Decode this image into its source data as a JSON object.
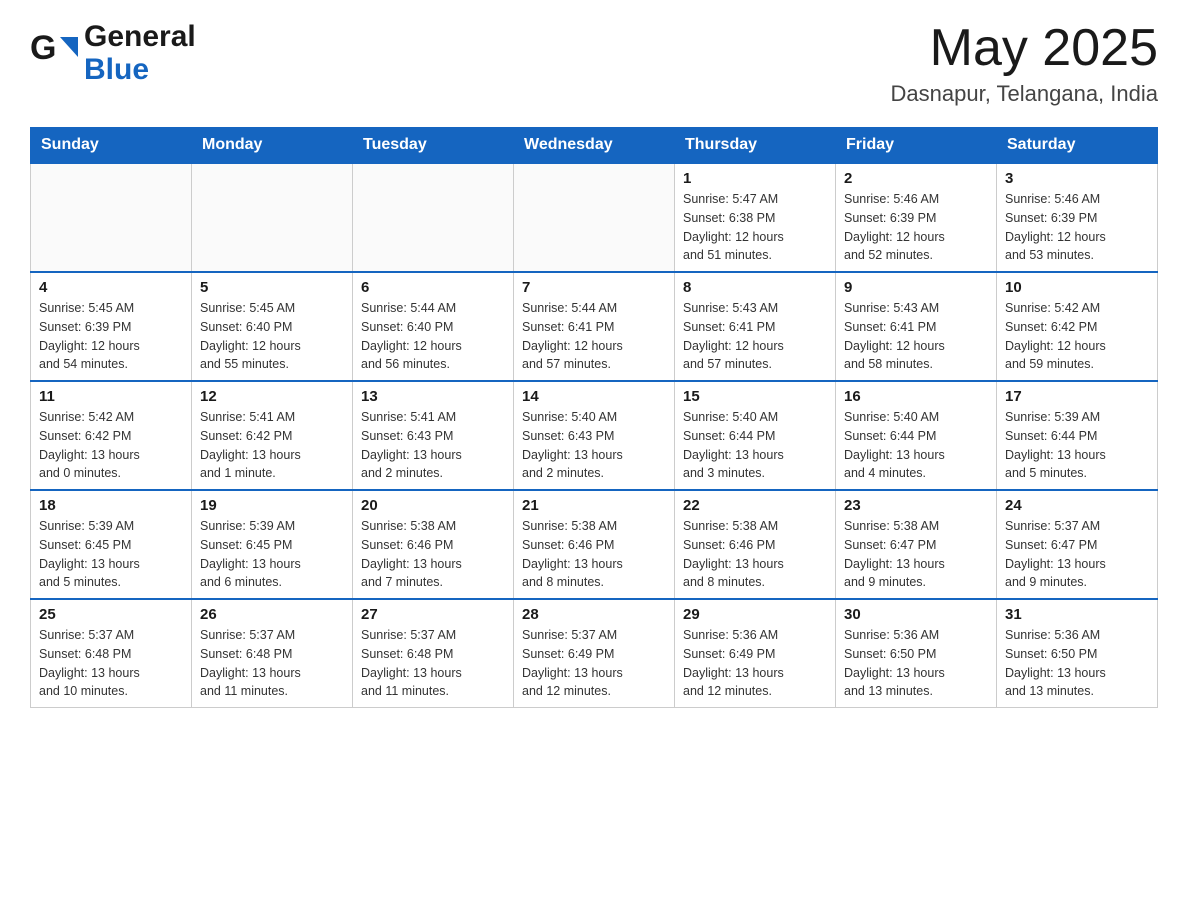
{
  "header": {
    "logo_general": "General",
    "logo_blue": "Blue",
    "month_title": "May 2025",
    "location": "Dasnapur, Telangana, India"
  },
  "days_of_week": [
    "Sunday",
    "Monday",
    "Tuesday",
    "Wednesday",
    "Thursday",
    "Friday",
    "Saturday"
  ],
  "weeks": [
    [
      {
        "day": "",
        "info": ""
      },
      {
        "day": "",
        "info": ""
      },
      {
        "day": "",
        "info": ""
      },
      {
        "day": "",
        "info": ""
      },
      {
        "day": "1",
        "info": "Sunrise: 5:47 AM\nSunset: 6:38 PM\nDaylight: 12 hours\nand 51 minutes."
      },
      {
        "day": "2",
        "info": "Sunrise: 5:46 AM\nSunset: 6:39 PM\nDaylight: 12 hours\nand 52 minutes."
      },
      {
        "day": "3",
        "info": "Sunrise: 5:46 AM\nSunset: 6:39 PM\nDaylight: 12 hours\nand 53 minutes."
      }
    ],
    [
      {
        "day": "4",
        "info": "Sunrise: 5:45 AM\nSunset: 6:39 PM\nDaylight: 12 hours\nand 54 minutes."
      },
      {
        "day": "5",
        "info": "Sunrise: 5:45 AM\nSunset: 6:40 PM\nDaylight: 12 hours\nand 55 minutes."
      },
      {
        "day": "6",
        "info": "Sunrise: 5:44 AM\nSunset: 6:40 PM\nDaylight: 12 hours\nand 56 minutes."
      },
      {
        "day": "7",
        "info": "Sunrise: 5:44 AM\nSunset: 6:41 PM\nDaylight: 12 hours\nand 57 minutes."
      },
      {
        "day": "8",
        "info": "Sunrise: 5:43 AM\nSunset: 6:41 PM\nDaylight: 12 hours\nand 57 minutes."
      },
      {
        "day": "9",
        "info": "Sunrise: 5:43 AM\nSunset: 6:41 PM\nDaylight: 12 hours\nand 58 minutes."
      },
      {
        "day": "10",
        "info": "Sunrise: 5:42 AM\nSunset: 6:42 PM\nDaylight: 12 hours\nand 59 minutes."
      }
    ],
    [
      {
        "day": "11",
        "info": "Sunrise: 5:42 AM\nSunset: 6:42 PM\nDaylight: 13 hours\nand 0 minutes."
      },
      {
        "day": "12",
        "info": "Sunrise: 5:41 AM\nSunset: 6:42 PM\nDaylight: 13 hours\nand 1 minute."
      },
      {
        "day": "13",
        "info": "Sunrise: 5:41 AM\nSunset: 6:43 PM\nDaylight: 13 hours\nand 2 minutes."
      },
      {
        "day": "14",
        "info": "Sunrise: 5:40 AM\nSunset: 6:43 PM\nDaylight: 13 hours\nand 2 minutes."
      },
      {
        "day": "15",
        "info": "Sunrise: 5:40 AM\nSunset: 6:44 PM\nDaylight: 13 hours\nand 3 minutes."
      },
      {
        "day": "16",
        "info": "Sunrise: 5:40 AM\nSunset: 6:44 PM\nDaylight: 13 hours\nand 4 minutes."
      },
      {
        "day": "17",
        "info": "Sunrise: 5:39 AM\nSunset: 6:44 PM\nDaylight: 13 hours\nand 5 minutes."
      }
    ],
    [
      {
        "day": "18",
        "info": "Sunrise: 5:39 AM\nSunset: 6:45 PM\nDaylight: 13 hours\nand 5 minutes."
      },
      {
        "day": "19",
        "info": "Sunrise: 5:39 AM\nSunset: 6:45 PM\nDaylight: 13 hours\nand 6 minutes."
      },
      {
        "day": "20",
        "info": "Sunrise: 5:38 AM\nSunset: 6:46 PM\nDaylight: 13 hours\nand 7 minutes."
      },
      {
        "day": "21",
        "info": "Sunrise: 5:38 AM\nSunset: 6:46 PM\nDaylight: 13 hours\nand 8 minutes."
      },
      {
        "day": "22",
        "info": "Sunrise: 5:38 AM\nSunset: 6:46 PM\nDaylight: 13 hours\nand 8 minutes."
      },
      {
        "day": "23",
        "info": "Sunrise: 5:38 AM\nSunset: 6:47 PM\nDaylight: 13 hours\nand 9 minutes."
      },
      {
        "day": "24",
        "info": "Sunrise: 5:37 AM\nSunset: 6:47 PM\nDaylight: 13 hours\nand 9 minutes."
      }
    ],
    [
      {
        "day": "25",
        "info": "Sunrise: 5:37 AM\nSunset: 6:48 PM\nDaylight: 13 hours\nand 10 minutes."
      },
      {
        "day": "26",
        "info": "Sunrise: 5:37 AM\nSunset: 6:48 PM\nDaylight: 13 hours\nand 11 minutes."
      },
      {
        "day": "27",
        "info": "Sunrise: 5:37 AM\nSunset: 6:48 PM\nDaylight: 13 hours\nand 11 minutes."
      },
      {
        "day": "28",
        "info": "Sunrise: 5:37 AM\nSunset: 6:49 PM\nDaylight: 13 hours\nand 12 minutes."
      },
      {
        "day": "29",
        "info": "Sunrise: 5:36 AM\nSunset: 6:49 PM\nDaylight: 13 hours\nand 12 minutes."
      },
      {
        "day": "30",
        "info": "Sunrise: 5:36 AM\nSunset: 6:50 PM\nDaylight: 13 hours\nand 13 minutes."
      },
      {
        "day": "31",
        "info": "Sunrise: 5:36 AM\nSunset: 6:50 PM\nDaylight: 13 hours\nand 13 minutes."
      }
    ]
  ]
}
